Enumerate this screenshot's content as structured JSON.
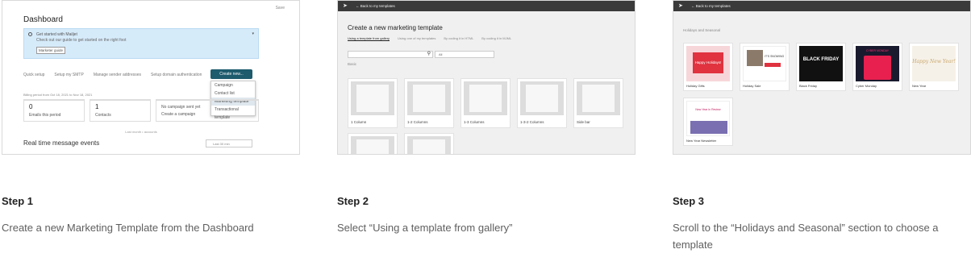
{
  "steps": [
    {
      "title": "Step 1",
      "description": "Create a new Marketing Template from the Dashboard",
      "screenshot": {
        "save": "Save",
        "page_title": "Dashboard",
        "banner_title": "Get started with Mailjet",
        "banner_text": "Check out our guide to get started on the right foot",
        "banner_button": "Marketer guide",
        "quick_setup": "Quick setup",
        "quick_items": [
          "Setup my SMTP",
          "Manage sender addresses",
          "Setup domain authentication"
        ],
        "create_button": "Create new...",
        "menu_items": [
          "Campaign",
          "Contact list",
          "Marketing template",
          "Transactional template"
        ],
        "selected_menu_item": "Marketing template",
        "billing_period": "Billing period from Oct 18, 2021 to Nov 18, 2021",
        "stats": [
          {
            "number": "0",
            "label": "Emails this period"
          },
          {
            "number": "1",
            "label": "Contacts"
          },
          {
            "number": "",
            "label": "No campaign sent yet"
          }
        ],
        "create_campaign": "Create a campaign",
        "last_month": "Last month • accounts",
        "real_time": "Real time message events",
        "last_dropdown": "Last 30 min"
      }
    },
    {
      "title": "Step 2",
      "description": "Select “Using a template from gallery”",
      "screenshot": {
        "back": "Back to my templates",
        "heading": "Create a new marketing template",
        "tabs": [
          "Using a template from gallery",
          "Using one of my templates",
          "By coding it in HTML",
          "By coding it in MJML"
        ],
        "active_tab": "Using a template from gallery",
        "filter_value": "All",
        "section": "Basic",
        "templates": [
          "1 Column",
          "1-2 Columns",
          "1-3 Columns",
          "1-3-2 Columns",
          "Side bar"
        ]
      }
    },
    {
      "title": "Step 3",
      "description": "Scroll to the “Holidays and Seasonal” section to choose a template",
      "screenshot": {
        "back": "Back to my templates",
        "section": "Holidays and Seasonal",
        "templates": [
          {
            "label": "Holiday Gifts",
            "thumb_text": "Happy Holidays!"
          },
          {
            "label": "Holiday Sale",
            "thumb_text": "IT'S SNOWING"
          },
          {
            "label": "Black Friday",
            "thumb_text": "BLACK FRIDAY"
          },
          {
            "label": "Cyber Monday",
            "thumb_text": "CYBER MONDAY"
          },
          {
            "label": "New Year",
            "thumb_text": "Happy New Year!"
          },
          {
            "label": "New Year Newsletter",
            "thumb_text": "New Year in Review"
          }
        ]
      }
    }
  ],
  "colors": {
    "accent": "#1e5b6d",
    "banner_bg": "#d6ebfa",
    "topbar": "#3a3a3a"
  }
}
